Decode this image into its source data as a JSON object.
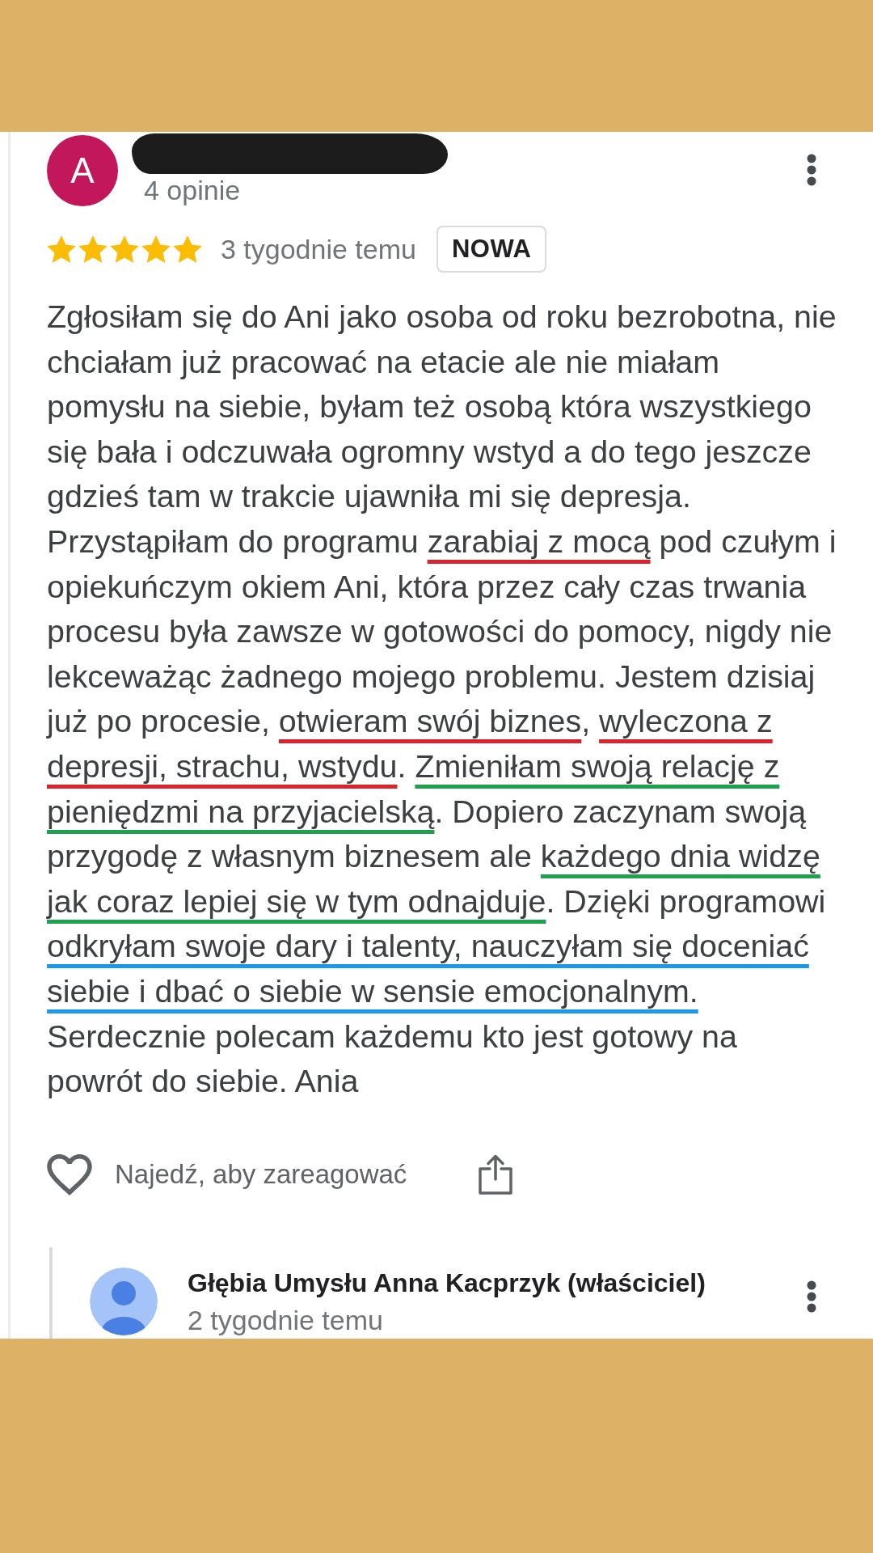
{
  "review": {
    "avatar_letter": "A",
    "name_redacted": true,
    "review_count": "4 opinie",
    "stars": 5,
    "time": "3 tygodnie temu",
    "badge": "NOWA",
    "segments": [
      {
        "text": "Zgłosiłam się do Ani jako osoba od roku bezrobotna, nie chciałam już pracować na etacie ale nie miałam pomysłu na siebie, byłam też osobą która wszystkiego się bała i odczuwała ogromny wstyd a do tego jeszcze gdzieś tam w trakcie ujawniła mi się depresja. Przystąpiłam do programu "
      },
      {
        "text": "zarabiaj z mocą",
        "color": "#d9232d"
      },
      {
        "text": " pod czułym i opiekuńczym okiem Ani, która przez cały czas trwania procesu była zawsze w gotowości do pomocy, nigdy nie lekceważąc żadnego mojego problemu. Jestem dzisiaj już po procesie, "
      },
      {
        "text": "otwieram swój biznes",
        "color": "#d9232d"
      },
      {
        "text": ", "
      },
      {
        "text": "wyleczona z depresji, strachu, wstydu",
        "color": "#d9232d"
      },
      {
        "text": ". "
      },
      {
        "text": "Zmieniłam swoją relację z pieniędzmi na przyjacielską",
        "color": "#21a150"
      },
      {
        "text": ". Dopiero zaczynam swoją przygodę z własnym biznesem ale "
      },
      {
        "text": "każdego dnia widzę jak coraz lepiej się w tym odnajduje",
        "color": "#21a150"
      },
      {
        "text": ". Dzięki programowi "
      },
      {
        "text": "odkryłam swoje dary i talenty, nauczyłam się doceniać siebie i dbać o siebie w sensie emocjonalnym.",
        "color": "#1b98ea"
      },
      {
        "text": " Serdecznie polecam każdemu kto jest gotowy na powrót do siebie. Ania"
      }
    ],
    "reaction_hint": "Najedź, aby zareagować"
  },
  "owner_reply": {
    "name": "Głębia Umysłu Anna Kacprzyk (właściciel)",
    "time": "2 tygodnie temu"
  }
}
